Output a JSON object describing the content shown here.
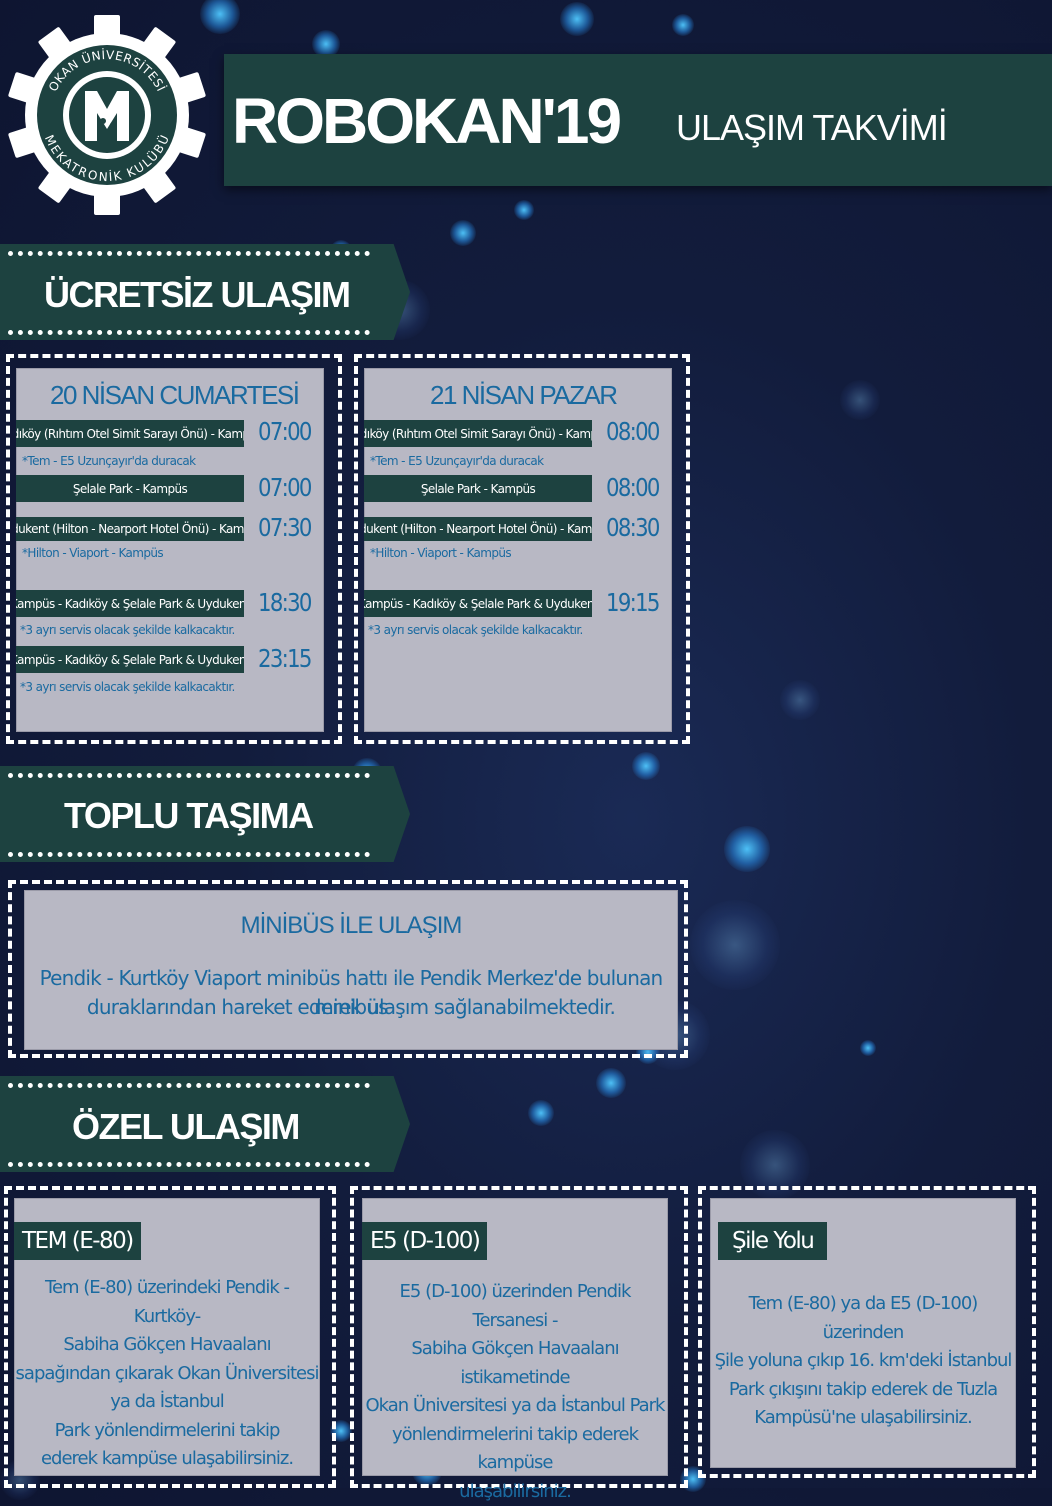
{
  "logo": {
    "ring_text_top": "OKAN ÜNİVERSİTESİ",
    "ring_text_bottom": "MEKATRONİK KULÜBÜ",
    "colors": {
      "ring": "#1d4240",
      "gear": "#ffffff"
    }
  },
  "header": {
    "title": "ROBOKAN'19",
    "subtitle": "ULAŞIM TAKVİMİ"
  },
  "sections": {
    "free": "ÜCRETSİZ ULAŞIM",
    "public": "TOPLU TAŞIMA",
    "private": "ÖZEL ULAŞIM"
  },
  "day1": {
    "title": "20 NİSAN CUMARTESİ",
    "rows": [
      {
        "route": "Kadıköy (Rıhtım Otel Simit Sarayı Önü) - Kampüs",
        "time": "07:00",
        "note": "*Tem - E5 Uzunçayır'da duracak"
      },
      {
        "route": "Şelale Park - Kampüs",
        "time": "07:00",
        "note": ""
      },
      {
        "route": "Uydukent (Hilton - Nearport Hotel Önü) - Kampüs",
        "time": "07:30",
        "note": "*Hilton - Viaport - Kampüs"
      },
      {
        "route": "Kampüs - Kadıköy & Şelale Park & Uydukent",
        "time": "18:30",
        "note": "*3 ayrı servis olacak şekilde kalkacaktır."
      },
      {
        "route": "Kampüs - Kadıköy & Şelale Park & Uydukent",
        "time": "23:15",
        "note": "*3 ayrı servis olacak şekilde kalkacaktır."
      }
    ]
  },
  "day2": {
    "title": "21 NİSAN PAZAR",
    "rows": [
      {
        "route": "Kadıköy (Rıhtım Otel Simit Sarayı Önü) - Kampüs",
        "time": "08:00",
        "note": "*Tem - E5 Uzunçayır'da duracak"
      },
      {
        "route": "Şelale Park - Kampüs",
        "time": "08:00",
        "note": ""
      },
      {
        "route": "Uydukent (Hilton - Nearport Hotel Önü) - Kampüs",
        "time": "08:30",
        "note": "*Hilton - Viaport - Kampüs"
      },
      {
        "route": "Kampüs - Kadıköy & Şelale Park & Uydukent",
        "time": "19:15",
        "note": "*3 ayrı servis olacak şekilde kalkacaktır."
      }
    ]
  },
  "minibus": {
    "title": "MİNİBÜS İLE ULAŞIM",
    "line1": "Pendik - Kurtköy Viaport  minibüs hattı ile Pendik Merkez'de bulunan minibüs",
    "line2": "duraklarından  hareket ederek ulaşım sağlanabilmektedir."
  },
  "private_routes": [
    {
      "tag": "TEM (E-80)",
      "lines": [
        "Tem (E-80) üzerindeki Pendik - Kurtköy-",
        "Sabiha Gökçen Havaalanı",
        "sapağından çıkarak Okan Üniversitesi",
        "ya da İstanbul",
        "Park yönlendirmelerini takip",
        "ederek kampüse ulaşabilirsiniz."
      ]
    },
    {
      "tag": "E5 (D-100)",
      "lines": [
        "E5 (D-100) üzerinden Pendik Tersanesi -",
        "Sabiha Gökçen Havaalanı istikametinde",
        "Okan Üniversitesi ya da İstanbul Park",
        "yönlendirmelerini takip ederek kampüse",
        "ulaşabilirsiniz."
      ]
    },
    {
      "tag": "Şile Yolu",
      "lines": [
        "Tem (E-80) ya da E5 (D-100) üzerinden",
        "Şile yoluna çıkıp 16. km'deki İstanbul",
        "Park çıkışını takip ederek de Tuzla",
        "Kampüsü'ne ulaşabilirsiniz."
      ]
    }
  ],
  "colors": {
    "accent_dark": "#1d4240",
    "text_blue": "#1a6aa0",
    "panel": "#b8b8c4",
    "background": "#121c3c"
  }
}
